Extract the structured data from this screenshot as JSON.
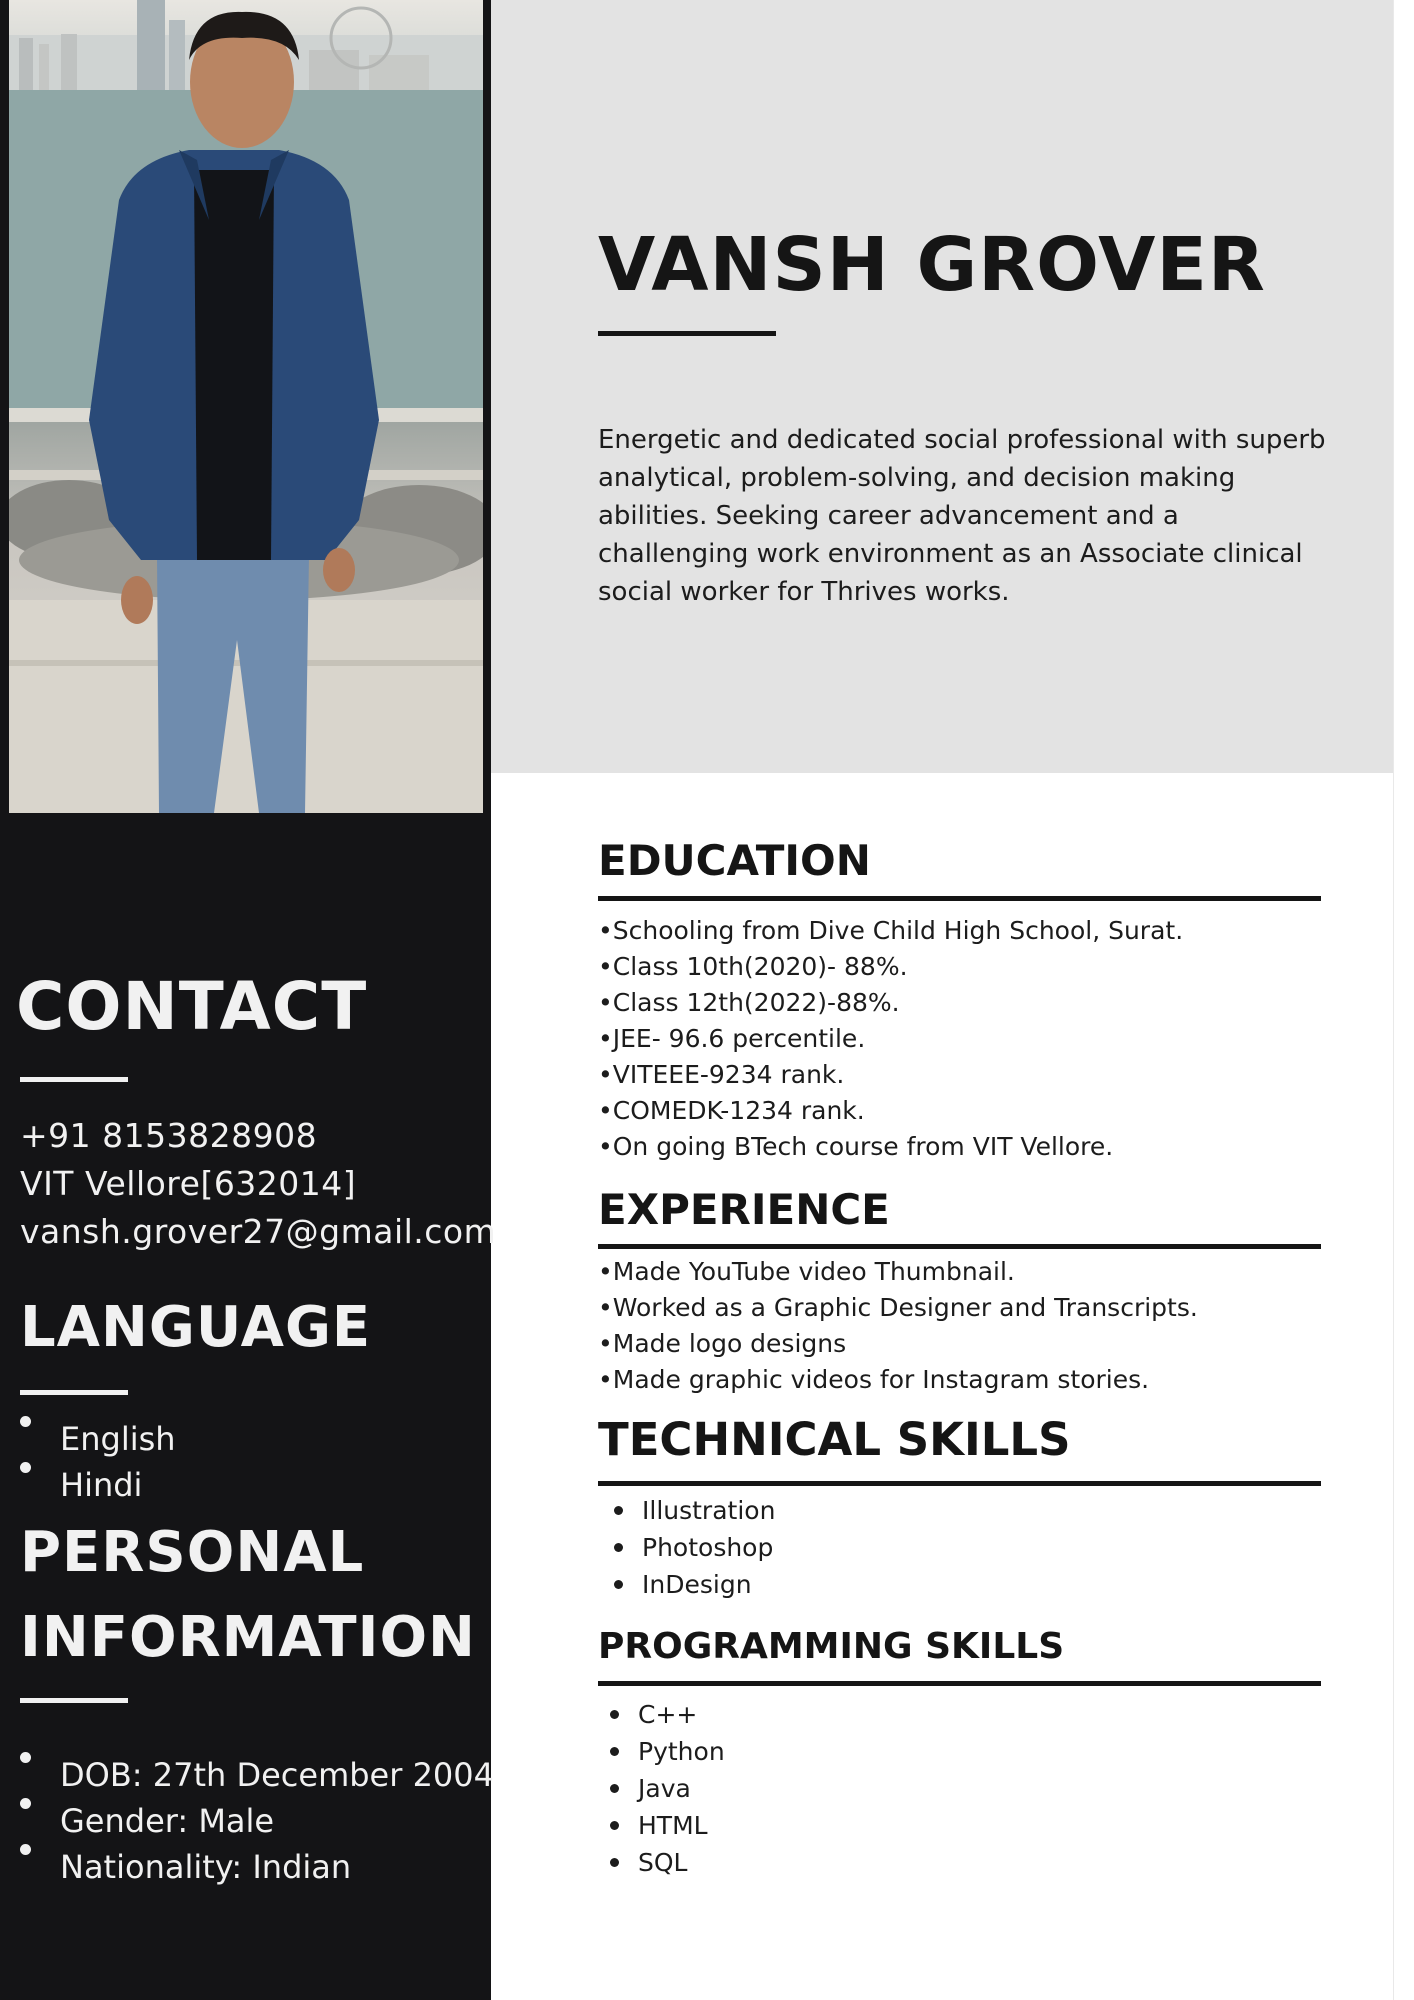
{
  "header": {
    "name": "VANSH GROVER",
    "summary": "Energetic and dedicated social professional with superb analytical, problem-solving, and decision making abilities. Seeking career advancement and a challenging work environment as an Associate clinical social worker for Thrives works."
  },
  "contact": {
    "heading": "CONTACT",
    "phone": "+91 8153828908",
    "address": "VIT Vellore[632014]",
    "email": "vansh.grover27@gmail.com"
  },
  "language": {
    "heading": "LANGUAGE",
    "items": [
      "English",
      "Hindi"
    ]
  },
  "personal": {
    "heading_line1": "PERSONAL",
    "heading_line2": "INFORMATION",
    "items": [
      "DOB: 27th December 2004",
      "Gender: Male",
      "Nationality: Indian"
    ]
  },
  "education": {
    "heading": "EDUCATION",
    "items": [
      "•Schooling from Dive Child High School, Surat.",
      "•Class 10th(2020)- 88%.",
      "•Class 12th(2022)-88%.",
      "•JEE- 96.6 percentile.",
      "•VITEEE-9234 rank.",
      "•COMEDK-1234 rank.",
      "•On going BTech course from VIT Vellore."
    ]
  },
  "experience": {
    "heading": "EXPERIENCE",
    "items": [
      "•Made YouTube video Thumbnail.",
      "•Worked as a Graphic Designer and Transcripts.",
      "•Made logo designs",
      "•Made graphic videos for Instagram stories."
    ]
  },
  "technical_skills": {
    "heading": "TECHNICAL SKILLS",
    "items": [
      "Illustration",
      "Photoshop",
      "InDesign"
    ]
  },
  "programming_skills": {
    "heading": "PROGRAMMING SKILLS",
    "items": [
      "C++",
      "Python",
      "Java",
      "HTML",
      "SQL"
    ]
  },
  "colors": {
    "sidebar": "#141416",
    "summary_panel": "#e3e3e3",
    "text_dark": "#151515",
    "text_light": "#f1f1f1"
  }
}
